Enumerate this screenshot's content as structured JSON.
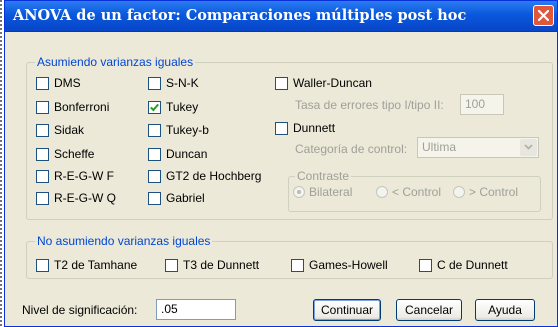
{
  "window": {
    "title": "ANOVA de un factor: Comparaciones múltiples post hoc"
  },
  "equal_group": {
    "legend": "Asumiendo varianzas iguales",
    "col1": [
      {
        "label": "DMS",
        "checked": false
      },
      {
        "label": "Bonferroni",
        "checked": false
      },
      {
        "label": "Sidak",
        "checked": false
      },
      {
        "label": "Scheffe",
        "checked": false
      },
      {
        "label": "R-E-G-W F",
        "checked": false
      },
      {
        "label": "R-E-G-W Q",
        "checked": false
      }
    ],
    "col2": [
      {
        "label": "S-N-K",
        "checked": false
      },
      {
        "label": "Tukey",
        "checked": true
      },
      {
        "label": "Tukey-b",
        "checked": false
      },
      {
        "label": "Duncan",
        "checked": false
      },
      {
        "label": "GT2 de Hochberg",
        "checked": false
      },
      {
        "label": "Gabriel",
        "checked": false
      }
    ],
    "waller": {
      "label": "Waller-Duncan",
      "checked": false
    },
    "ratio_label": "Tasa de errores tipo I/tipo II:",
    "ratio_value": "100",
    "dunnett": {
      "label": "Dunnett",
      "checked": false
    },
    "control_label": "Categoría de control:",
    "control_value": "Ultima",
    "contrast": {
      "legend": "Contraste",
      "options": [
        "Bilateral",
        "< Control",
        "> Control"
      ],
      "selected": "Bilateral"
    }
  },
  "unequal_group": {
    "legend": "No asumiendo varianzas iguales",
    "items": [
      {
        "label": "T2 de Tamhane",
        "checked": false
      },
      {
        "label": "T3 de Dunnett",
        "checked": false
      },
      {
        "label": "Games-Howell",
        "checked": false
      },
      {
        "label": "C de Dunnett",
        "checked": false
      }
    ]
  },
  "footer": {
    "sig_label": "Nivel de significación:",
    "sig_value": ".05",
    "continue_label": "Continuar",
    "cancel_label": "Cancelar",
    "help_label": "Ayuda"
  },
  "colors": {
    "titlebar": "#0a58dd",
    "dialog_bg": "#ece9d8",
    "group_legend": "#0046d5",
    "close_button": "#e0573a"
  }
}
